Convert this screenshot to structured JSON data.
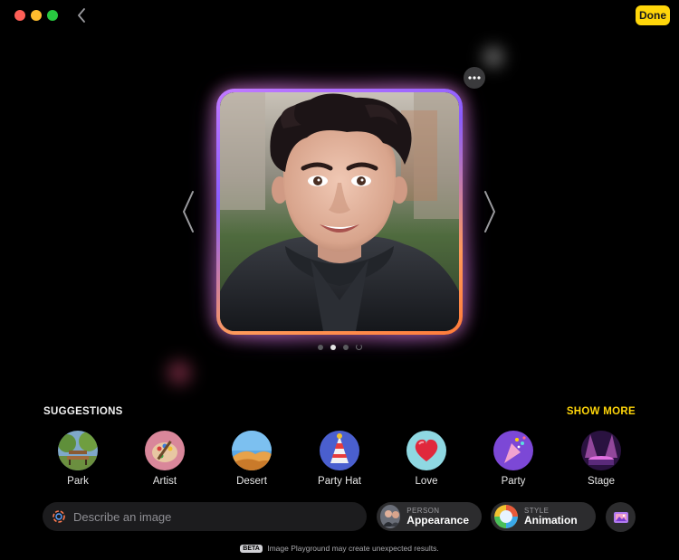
{
  "window": {
    "done_label": "Done"
  },
  "canvas": {
    "page_indicator": {
      "total_dots": 3,
      "active_index": 1,
      "loading": true
    },
    "colors": {
      "glow_purple": "#c37bff",
      "glow_orange": "#ff9a5a",
      "accent": "#ffd60a"
    }
  },
  "suggestions": {
    "title": "SUGGESTIONS",
    "show_more_label": "SHOW MORE",
    "items": [
      {
        "label": "Park",
        "icon": "park-bench-icon"
      },
      {
        "label": "Artist",
        "icon": "palette-icon"
      },
      {
        "label": "Desert",
        "icon": "desert-icon"
      },
      {
        "label": "Party Hat",
        "icon": "party-hat-icon"
      },
      {
        "label": "Love",
        "icon": "heart-icon"
      },
      {
        "label": "Party",
        "icon": "party-popper-icon"
      },
      {
        "label": "Stage",
        "icon": "stage-icon"
      }
    ]
  },
  "prompt": {
    "placeholder": "Describe an image",
    "value": ""
  },
  "person_pill": {
    "kicker": "PERSON",
    "value": "Appearance"
  },
  "style_pill": {
    "kicker": "STYLE",
    "value": "Animation"
  },
  "footer": {
    "badge": "BETA",
    "text": "Image Playground may create unexpected results."
  }
}
